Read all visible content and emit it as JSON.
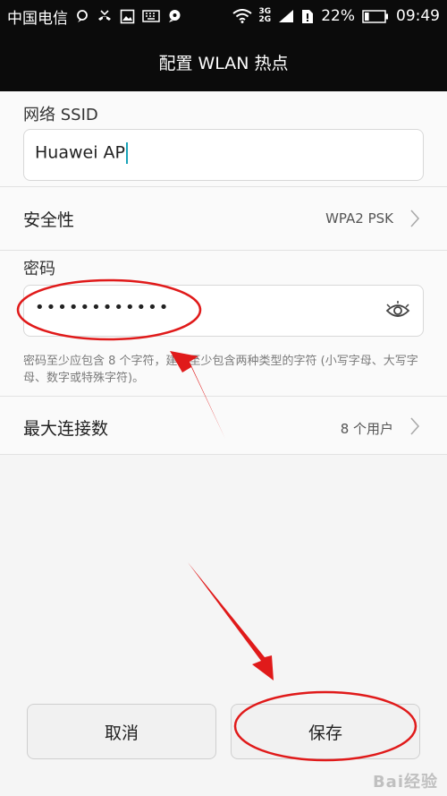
{
  "status_bar": {
    "carrier": "中国电信",
    "network_top": "3G",
    "network_bottom": "2G",
    "battery_percent": "22%",
    "battery_level": 0.22,
    "time": "09:49",
    "icons": [
      "chat-icon",
      "missed-call-icon",
      "image-icon",
      "keyboard-icon",
      "bubble-icon",
      "wifi-icon",
      "signal-icon",
      "sim-icon",
      "battery-icon"
    ]
  },
  "header": {
    "title": "配置 WLAN 热点"
  },
  "ssid": {
    "label": "网络 SSID",
    "value": "Huawei AP"
  },
  "security": {
    "label": "安全性",
    "value": "WPA2 PSK"
  },
  "password": {
    "label": "密码",
    "masked_value": "••••••••••••"
  },
  "hint": {
    "text": "密码至少应包含 8 个字符，建议至少包含两种类型的字符 (小写字母、大写字母、数字或特殊字符)。"
  },
  "max_connections": {
    "label": "最大连接数",
    "value": "8 个用户"
  },
  "buttons": {
    "cancel": "取消",
    "save": "保存"
  },
  "watermark": {
    "text": "Bai经验"
  },
  "colors": {
    "accent": "#1aa3b8",
    "annotation": "#e01a1a",
    "bar": "#0b0b0b"
  }
}
